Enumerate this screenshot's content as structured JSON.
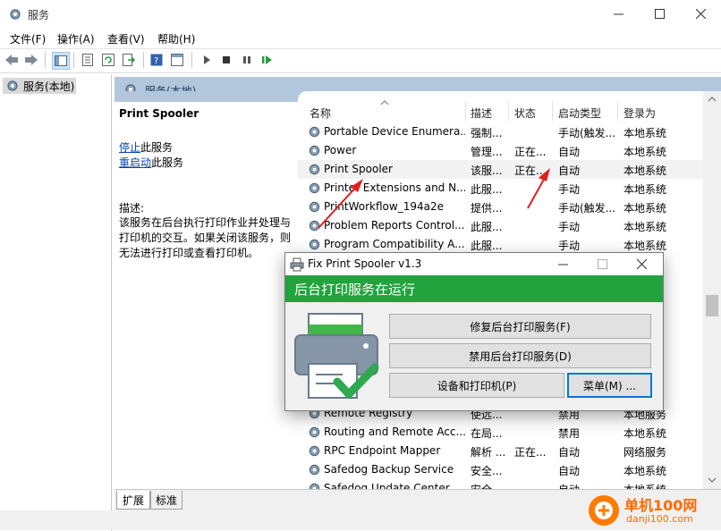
{
  "window": {
    "title": "服务"
  },
  "menu": [
    "文件(F)",
    "操作(A)",
    "查看(V)",
    "帮助(H)"
  ],
  "tree": {
    "item": "服务(本地)"
  },
  "band": {
    "title": "服务(本地)"
  },
  "detail": {
    "service_name": "Print Spooler",
    "stop_link": "停止",
    "stop_suffix": "此服务",
    "restart_link": "重启动",
    "restart_suffix": "此服务",
    "desc_label": "描述:",
    "desc_lines": [
      "该服务在后台执行打印作业并处理与",
      "打印机的交互。如果关闭该服务，则",
      "无法进行打印或查看打印机。"
    ]
  },
  "columns": [
    "名称",
    "描述",
    "状态",
    "启动类型",
    "登录为"
  ],
  "rows": [
    [
      "Portable Device Enumera...",
      "强制...",
      "",
      "手动(触发...",
      "本地系统"
    ],
    [
      "Power",
      "管理...",
      "正在...",
      "自动",
      "本地系统"
    ],
    [
      "Print Spooler",
      "该服...",
      "正在...",
      "自动",
      "本地系统"
    ],
    [
      "Printer Extensions and N...",
      "此服...",
      "",
      "手动",
      "本地系统"
    ],
    [
      "PrintWorkflow_194a2e",
      "提供...",
      "",
      "手动(触发...",
      "本地系统"
    ],
    [
      "Problem Reports Control...",
      "此服...",
      "",
      "手动",
      "本地系统"
    ],
    [
      "Program Compatibility A...",
      "此服...",
      "",
      "手动",
      "本地系统"
    ]
  ],
  "rows_bottom": [
    [
      "Remote Registry",
      "使远...",
      "",
      "禁用",
      "本地服务"
    ],
    [
      "Routing and Remote Acc...",
      "在局...",
      "",
      "禁用",
      "本地系统"
    ],
    [
      "RPC Endpoint Mapper",
      "解析 ...",
      "正在...",
      "自动",
      "网络服务"
    ],
    [
      "Safedog Backup Service",
      "安全...",
      "",
      "自动",
      "本地系统"
    ],
    [
      "Safedog Update Center",
      "安全...",
      "",
      "自动",
      "本地系统"
    ]
  ],
  "tabs": [
    "扩展",
    "标准"
  ],
  "dialog": {
    "title": "Fix Print Spooler v1.3",
    "status": "后台打印服务在运行",
    "btn_repair": "修复后台打印服务(F)",
    "btn_disable": "禁用后台打印服务(D)",
    "btn_devices": "设备和打印机(P)",
    "btn_menu": "菜单(M) ...",
    "colors": {
      "accent": "#22a33e"
    }
  },
  "watermark": {
    "name": "单机100网",
    "url": "danji100.com"
  }
}
